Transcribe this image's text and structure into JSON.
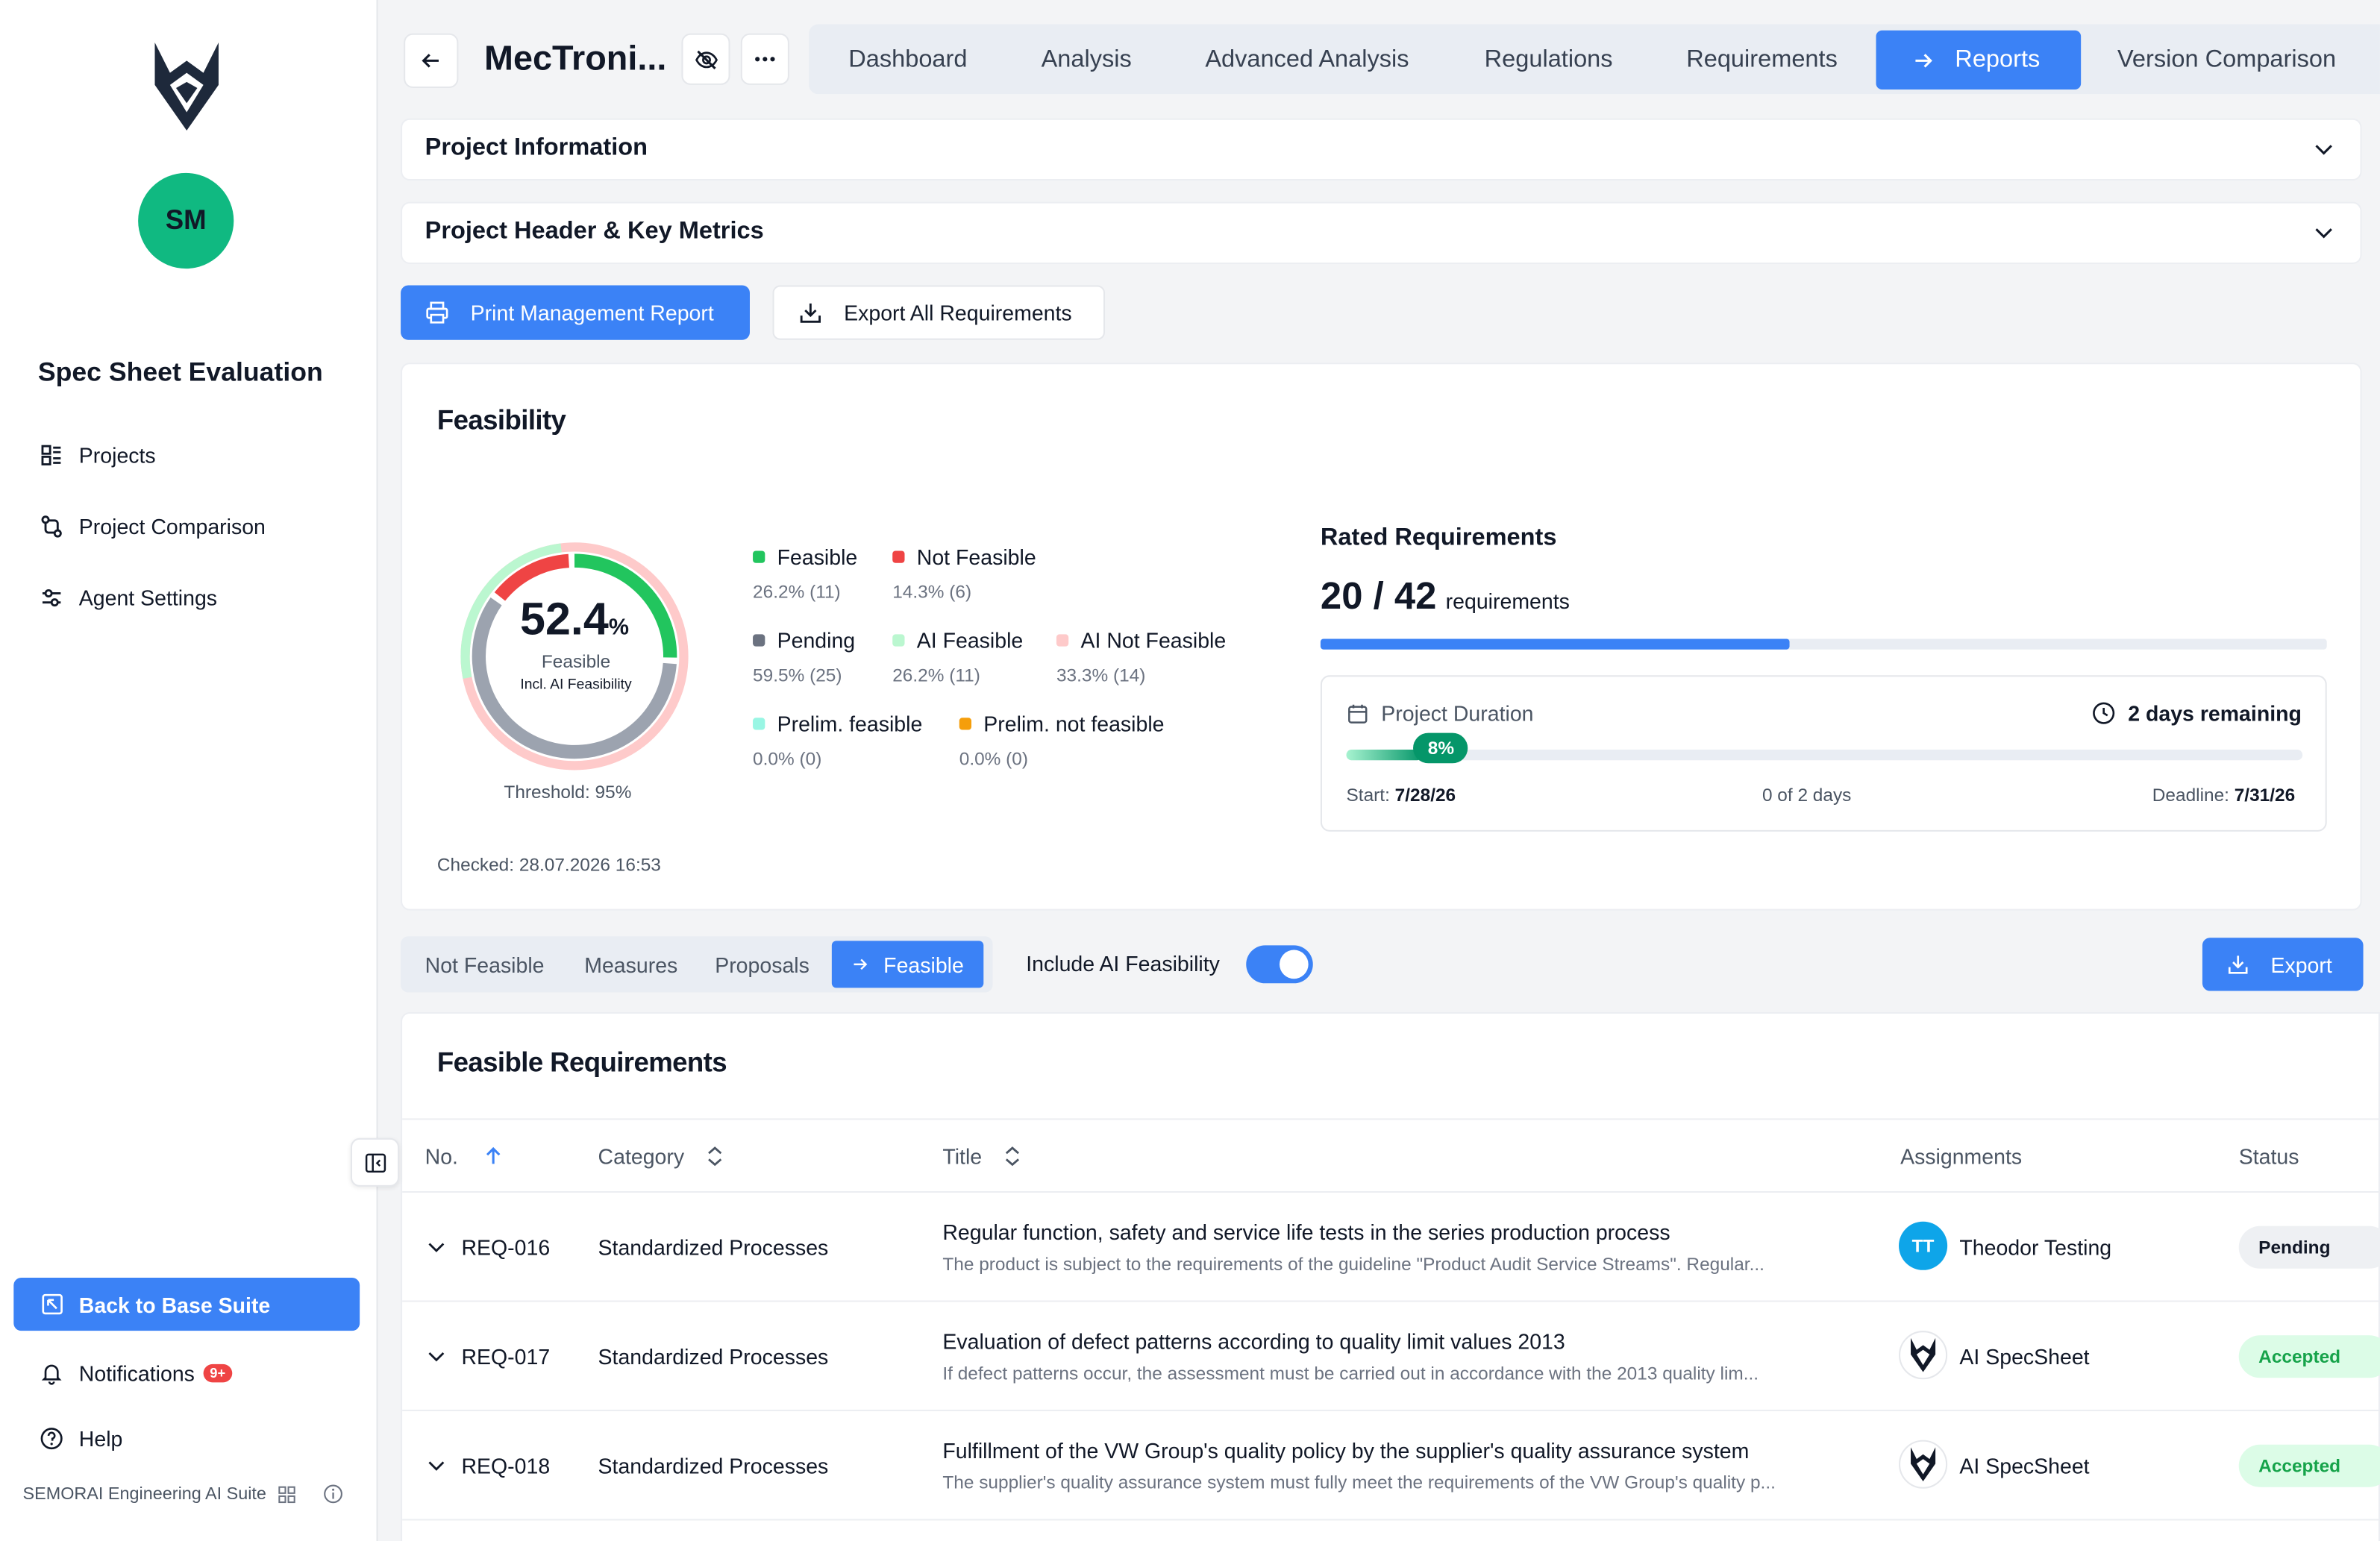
{
  "sidebar": {
    "user_initials": "SM",
    "app_title": "Spec Sheet Evaluation",
    "nav": [
      {
        "label": "Projects",
        "icon": "projects-icon"
      },
      {
        "label": "Project Comparison",
        "icon": "compare-icon"
      },
      {
        "label": "Agent Settings",
        "icon": "settings-icon"
      }
    ],
    "back_label": "Back to Base Suite",
    "notifications_label": "Notifications",
    "notifications_badge": "9+",
    "help_label": "Help",
    "footer_text": "SEMORAI Engineering AI Suite"
  },
  "header": {
    "project_title": "MecTroni...",
    "tabs": [
      "Dashboard",
      "Analysis",
      "Advanced Analysis",
      "Regulations",
      "Requirements",
      "Reports",
      "Version Comparison"
    ],
    "active_tab": "Reports"
  },
  "accordions": {
    "project_info": "Project Information",
    "project_header": "Project Header & Key Metrics"
  },
  "actions": {
    "print_label": "Print Management Report",
    "export_all_label": "Export All Requirements"
  },
  "feasibility": {
    "title": "Feasibility",
    "percent": "52.4",
    "percent_sign": "%",
    "gauge_label": "Feasible",
    "gauge_sublabel": "Incl. AI Feasibility",
    "threshold": "Threshold: 95%",
    "checked": "Checked: 28.07.2026 16:53",
    "legend": [
      {
        "label": "Feasible",
        "value": "26.2% (11)",
        "color": "#22c55e"
      },
      {
        "label": "Not Feasible",
        "value": "14.3% (6)",
        "color": "#ef4444"
      },
      {
        "label": "Pending",
        "value": "59.5% (25)",
        "color": "#6b7280"
      },
      {
        "label": "AI Feasible",
        "value": "26.2% (11)",
        "color": "#bbf7d0"
      },
      {
        "label": "AI Not Feasible",
        "value": "33.3% (14)",
        "color": "#fecaca"
      },
      {
        "label": "Prelim. feasible",
        "value": "0.0% (0)",
        "color": "#99f6e4"
      },
      {
        "label": "Prelim. not feasible",
        "value": "0.0% (0)",
        "color": "#f59e0b"
      }
    ],
    "gauge_segments": {
      "feasible": 0.262,
      "not_feasible": 0.143,
      "pending": 0.595,
      "ai_feasible": 0.262,
      "ai_not_feasible": 0.333
    }
  },
  "rated": {
    "title": "Rated Requirements",
    "count": "20 / 42",
    "unit": "requirements",
    "progress": 0.476
  },
  "duration": {
    "title": "Project Duration",
    "remaining": "2 days remaining",
    "percent_label": "8%",
    "progress": 0.08,
    "start_label": "Start:",
    "start_value": "7/28/26",
    "middle": "0 of 2 days",
    "deadline_label": "Deadline:",
    "deadline_value": "7/31/26"
  },
  "filters": {
    "tabs": [
      "Not Feasible",
      "Measures",
      "Proposals",
      "Feasible"
    ],
    "active": "Feasible",
    "toggle_label": "Include AI Feasibility",
    "toggle_on": true,
    "export_label": "Export"
  },
  "table": {
    "title": "Feasible Requirements",
    "columns": [
      "No.",
      "Category",
      "Title",
      "Assignments",
      "Status"
    ],
    "rows": [
      {
        "no": "REQ-016",
        "category": "Standardized Processes",
        "title": "Regular function, safety and service life tests in the series production process",
        "desc": "The product is subject to the requirements of the guideline \"Product Audit Service Streams\". Regular...",
        "assignee_initials": "TT",
        "assignee": "Theodor Testing",
        "status": "Pending"
      },
      {
        "no": "REQ-017",
        "category": "Standardized Processes",
        "title": "Evaluation of defect patterns according to quality limit values 2013",
        "desc": "If defect patterns occur, the assessment must be carried out in accordance with the 2013 quality lim...",
        "assignee_initials": "",
        "assignee": "AI SpecSheet",
        "status": "Accepted"
      },
      {
        "no": "REQ-018",
        "category": "Standardized Processes",
        "title": "Fulfillment of the VW Group's quality policy by the supplier's quality assurance system",
        "desc": "The supplier's quality assurance system must fully meet the requirements of the VW Group's quality p...",
        "assignee_initials": "",
        "assignee": "AI SpecSheet",
        "status": "Accepted"
      }
    ]
  }
}
